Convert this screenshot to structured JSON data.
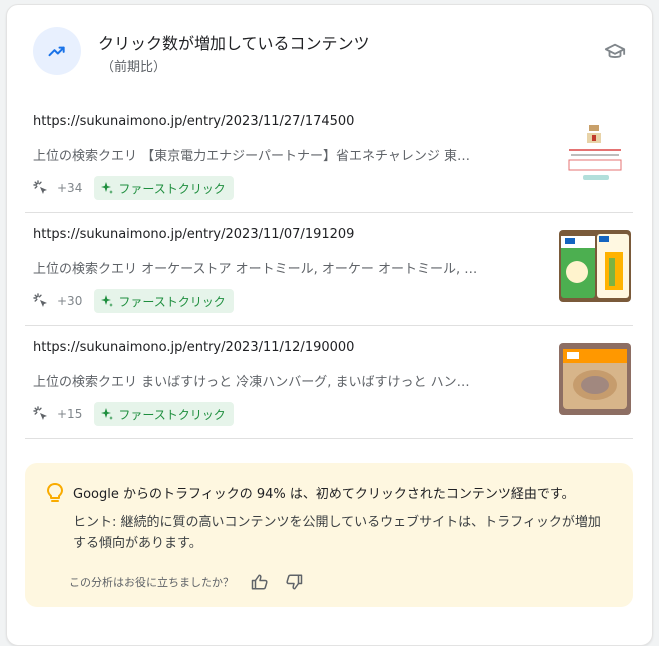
{
  "header": {
    "title": "クリック数が増加しているコンテンツ",
    "subtitle": "（前期比）"
  },
  "items": [
    {
      "url": "https://sukunaimono.jp/entry/2023/11/27/174500",
      "query_prefix": "上位の検索クエリ",
      "query": "【東京電力エナジーパートナー】省エネチャレンジ 東…",
      "count": "+34",
      "badge": "ファーストクリック"
    },
    {
      "url": "https://sukunaimono.jp/entry/2023/11/07/191209",
      "query_prefix": "上位の検索クエリ",
      "query": "オーケーストア オートミール, オーケー オートミール, …",
      "count": "+30",
      "badge": "ファーストクリック"
    },
    {
      "url": "https://sukunaimono.jp/entry/2023/11/12/190000",
      "query_prefix": "上位の検索クエリ",
      "query": "まいばすけっと 冷凍ハンバーグ, まいばすけっと ハン…",
      "count": "+15",
      "badge": "ファーストクリック"
    }
  ],
  "insight": {
    "main": "Google からのトラフィックの 94% は、初めてクリックされたコンテンツ経由です。",
    "hint": "ヒント: 継続的に質の高いコンテンツを公開しているウェブサイトは、トラフィックが増加する傾向があります。",
    "feedback_question": "この分析はお役に立ちましたか？"
  },
  "icons": {
    "trend": "trending-up-icon",
    "school": "school-icon",
    "click": "click-icon",
    "sparkle": "sparkle-icon",
    "bulb": "lightbulb-icon",
    "thumbs_up": "thumb-up-icon",
    "thumbs_down": "thumb-down-icon"
  },
  "colors": {
    "accent_blue": "#1a73e8",
    "chip_bg": "#e6f4ea",
    "chip_text": "#1e8e3e",
    "insight_bg": "#fef7e0",
    "bulb": "#f9ab00"
  }
}
